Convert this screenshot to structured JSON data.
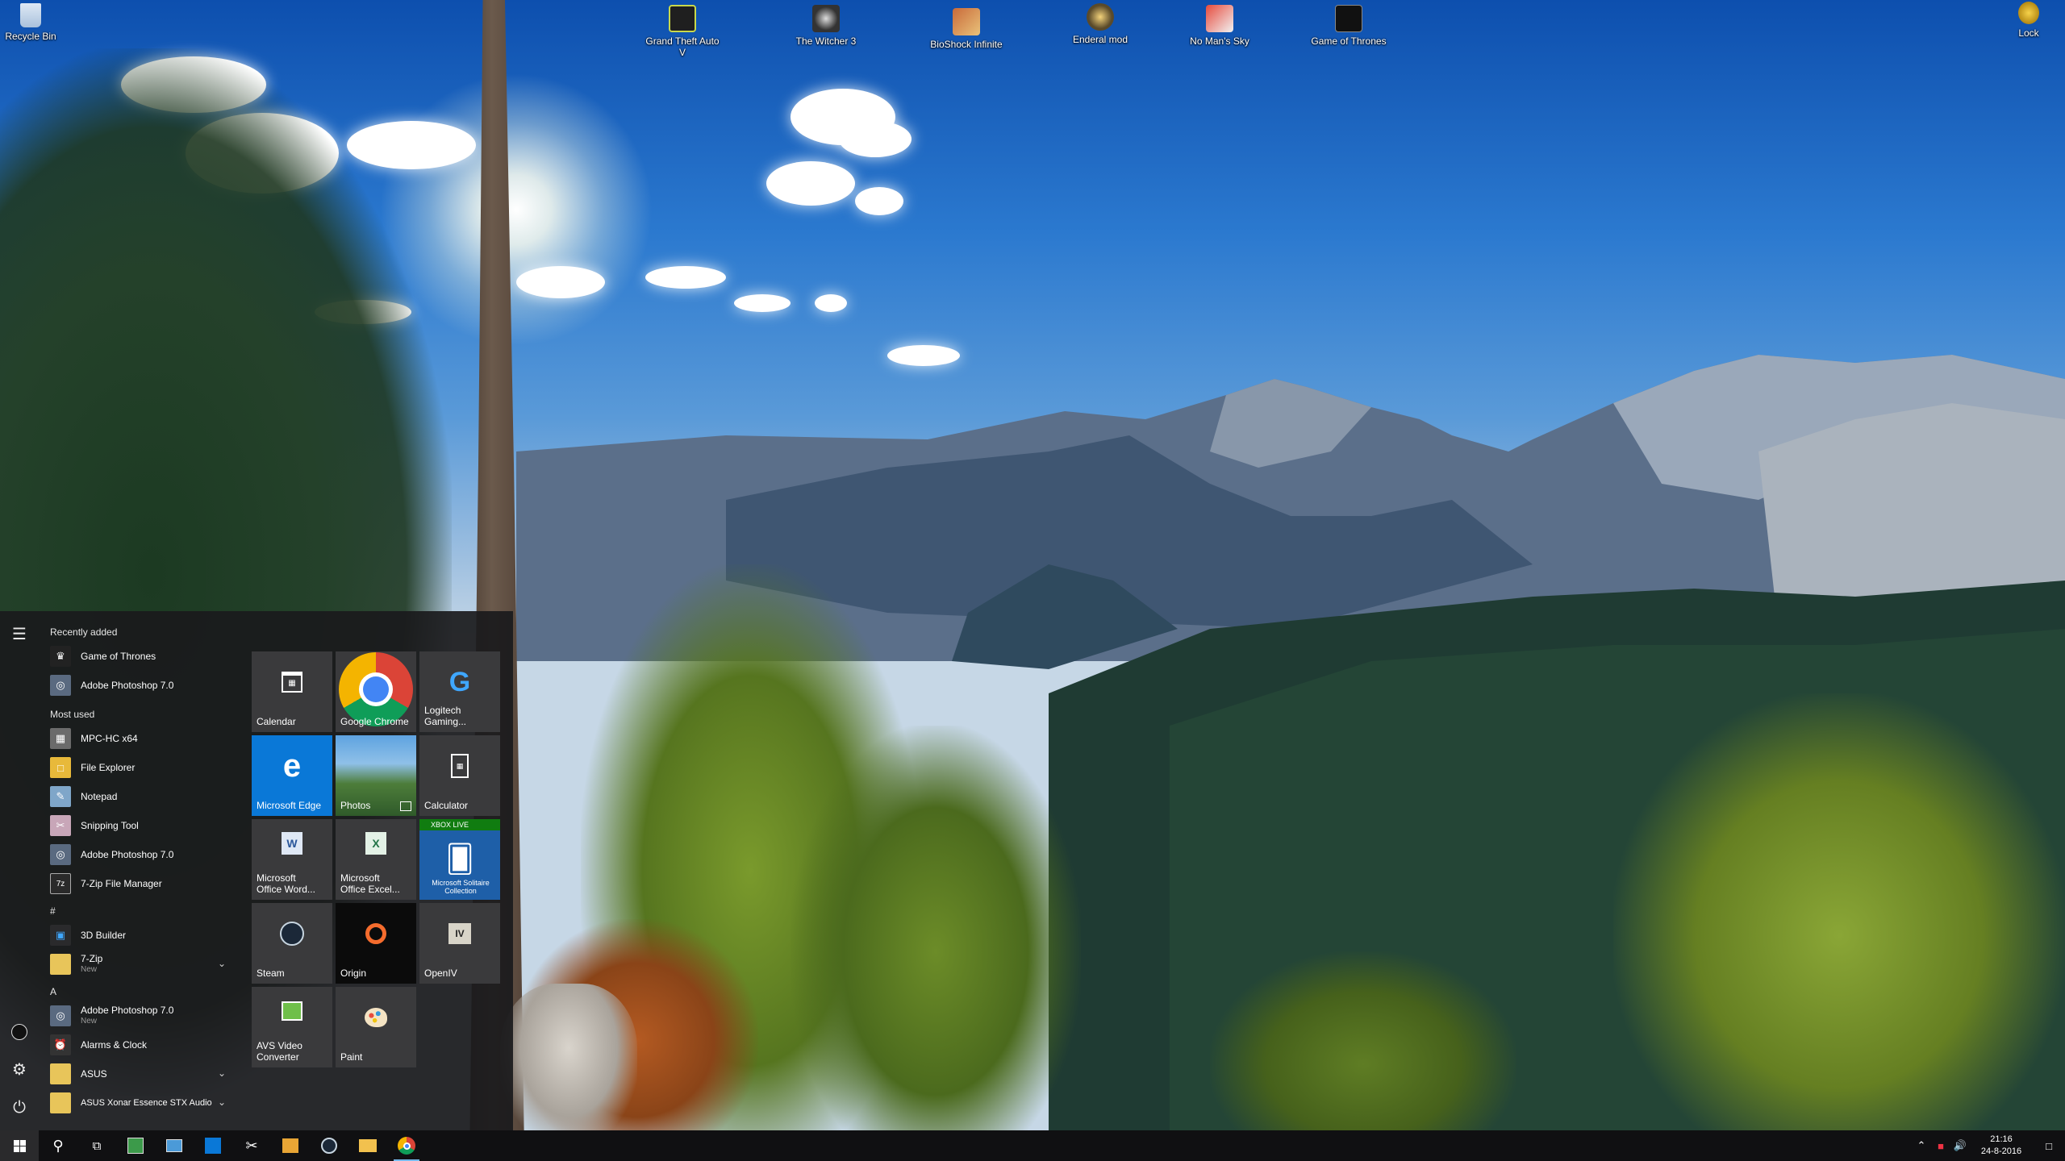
{
  "desktop": {
    "icons": [
      {
        "label": "Recycle Bin",
        "icon": "recycle-bin-icon"
      },
      {
        "label": "Grand Theft Auto V",
        "icon": "gta-icon"
      },
      {
        "label": "The Witcher 3",
        "icon": "witcher-icon"
      },
      {
        "label": "BioShock Infinite",
        "icon": "bioshock-icon"
      },
      {
        "label": "Enderal mod",
        "icon": "enderal-icon"
      },
      {
        "label": "No Man's Sky",
        "icon": "no-mans-sky-icon"
      },
      {
        "label": "Game of Thrones",
        "icon": "game-of-thrones-icon"
      },
      {
        "label": "Lock",
        "icon": "lock-icon"
      }
    ]
  },
  "start_menu": {
    "sections": {
      "recently_added": "Recently added",
      "most_used": "Most used",
      "hash": "#",
      "a": "A"
    },
    "recently_added": [
      {
        "label": "Game of Thrones"
      },
      {
        "label": "Adobe Photoshop 7.0"
      }
    ],
    "most_used": [
      {
        "label": "MPC-HC x64"
      },
      {
        "label": "File Explorer"
      },
      {
        "label": "Notepad"
      },
      {
        "label": "Snipping Tool"
      },
      {
        "label": "Adobe Photoshop 7.0"
      },
      {
        "label": "7-Zip File Manager"
      }
    ],
    "hash_apps": [
      {
        "label": "3D Builder",
        "sub": ""
      },
      {
        "label": "7-Zip",
        "sub": "New"
      }
    ],
    "a_apps": [
      {
        "label": "Adobe Photoshop 7.0",
        "sub": "New"
      },
      {
        "label": "Alarms & Clock",
        "sub": ""
      },
      {
        "label": "ASUS",
        "sub": ""
      },
      {
        "label": "ASUS Xonar Essence STX Audio",
        "sub": ""
      }
    ],
    "tiles": [
      {
        "label": "Calendar",
        "color": "#3a3a3c"
      },
      {
        "label": "Google Chrome",
        "color": "#3a3a3c"
      },
      {
        "label": "Logitech Gaming...",
        "color": "#3a3a3c"
      },
      {
        "label": "Microsoft Edge",
        "color": "#0a78d7"
      },
      {
        "label": "Photos",
        "color": "#3a3a3c"
      },
      {
        "label": "Calculator",
        "color": "#3a3a3c"
      },
      {
        "label": "Microsoft Office Word...",
        "color": "#3a3a3c"
      },
      {
        "label": "Microsoft Office Excel...",
        "color": "#3a3a3c"
      },
      {
        "label": "Microsoft Solitaire Collection",
        "color": "#1e5fa8",
        "badge": "XBOX LIVE"
      },
      {
        "label": "Steam",
        "color": "#3a3a3c"
      },
      {
        "label": "Origin",
        "color": "#0b0b0b"
      },
      {
        "label": "OpenIV",
        "color": "#3a3a3c"
      },
      {
        "label": "AVS Video Converter",
        "color": "#3a3a3c"
      },
      {
        "label": "Paint",
        "color": "#3a3a3c"
      }
    ]
  },
  "taskbar": {
    "clock_time": "21:16",
    "clock_date": "24-8-2016"
  }
}
